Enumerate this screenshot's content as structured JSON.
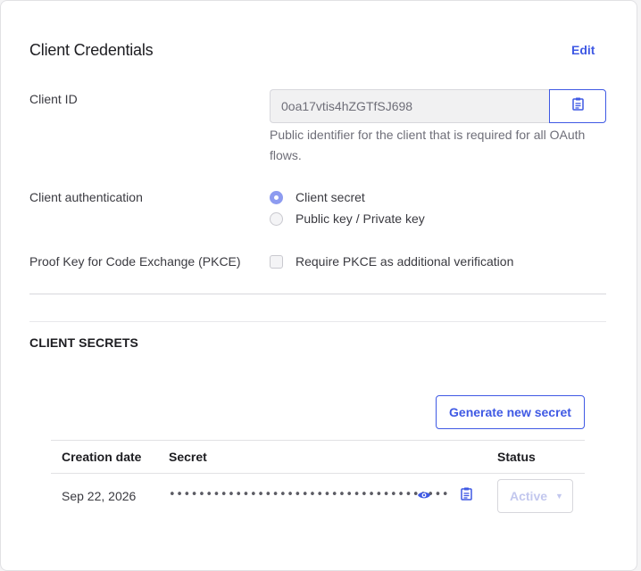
{
  "header": {
    "title": "Client Credentials",
    "edit_label": "Edit"
  },
  "client_id": {
    "label": "Client ID",
    "value": "0oa17vtis4hZGTfSJ698",
    "hint": "Public identifier for the client that is required for all OAuth flows.",
    "copy_icon": "clipboard-icon"
  },
  "client_authentication": {
    "label": "Client authentication",
    "options": [
      {
        "label": "Client secret",
        "selected": true
      },
      {
        "label": "Public key / Private key",
        "selected": false
      }
    ]
  },
  "pkce": {
    "label": "Proof Key for Code Exchange (PKCE)",
    "checkbox_label": "Require PKCE as additional verification",
    "checked": false
  },
  "client_secrets": {
    "title": "CLIENT SECRETS",
    "generate_label": "Generate new secret",
    "columns": [
      "Creation date",
      "Secret",
      "Status"
    ],
    "rows": [
      {
        "creation_date": "Sep 22, 2026",
        "secret_masked": "••••••••••••••••••••••••••••••••••••••",
        "status": "Active"
      }
    ]
  },
  "colors": {
    "accent": "#3f59e4",
    "radio_checked": "#8d9bf0",
    "muted_text": "#6e6e78"
  }
}
